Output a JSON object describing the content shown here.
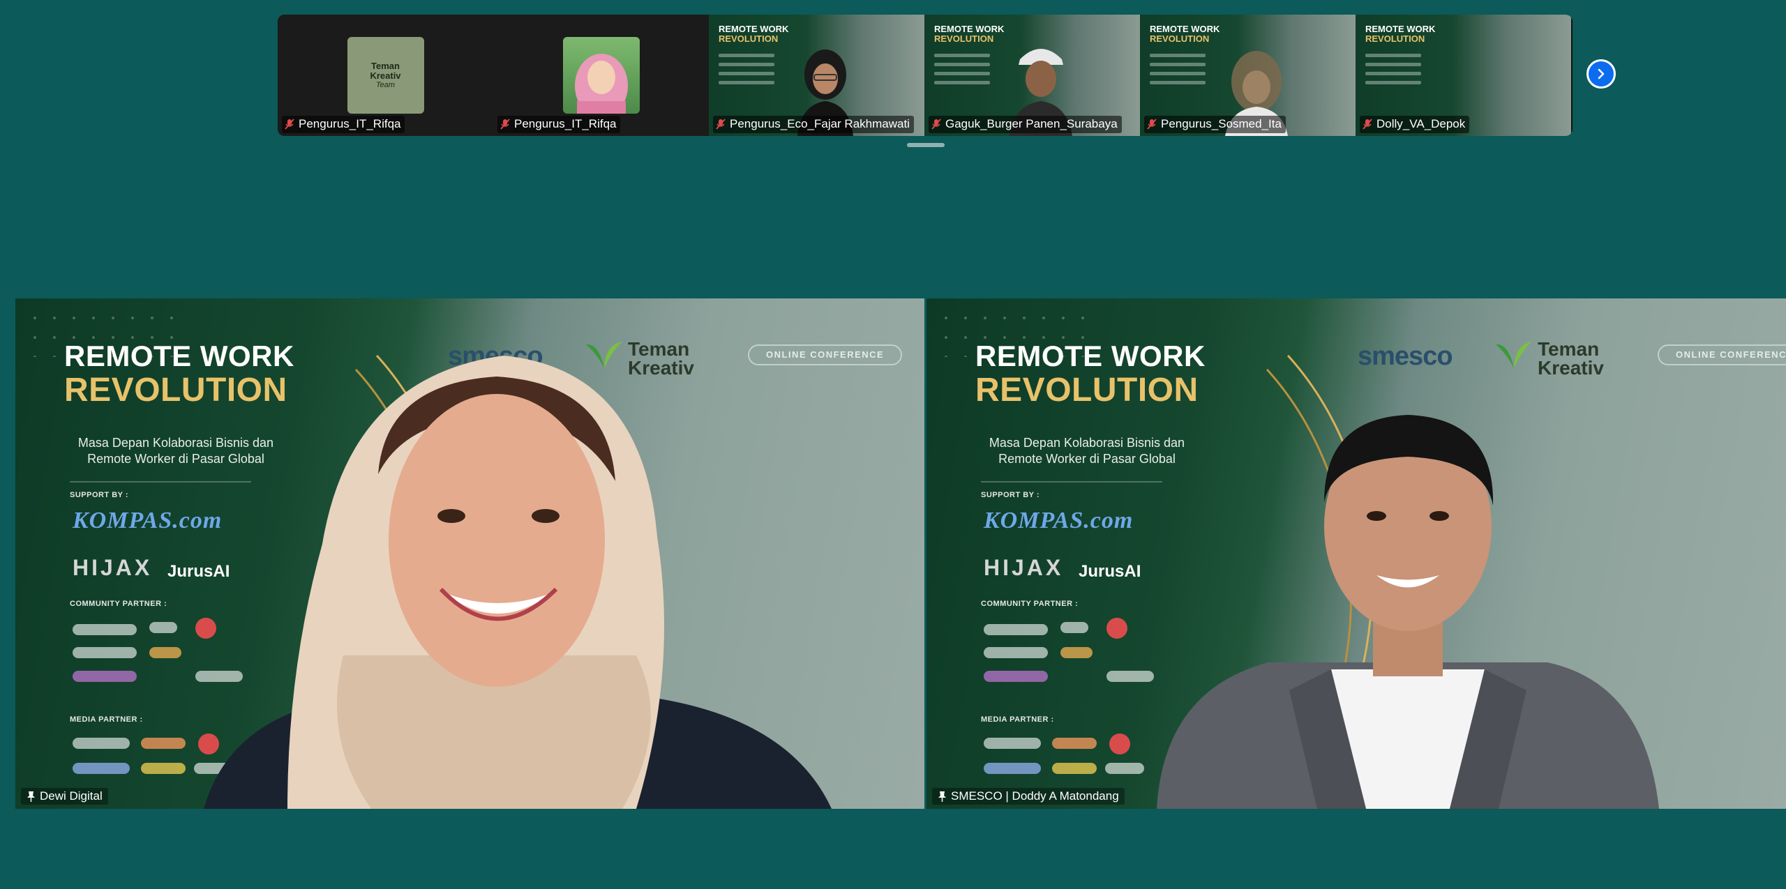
{
  "participants": [
    {
      "name": "Pengurus_IT_Rifqa",
      "tile": "avatar-teman",
      "avatar_text": [
        "Teman",
        "Kreativ",
        "Team"
      ],
      "muted": true
    },
    {
      "name": "Pengurus_IT_Rifqa",
      "tile": "avatar-hijab",
      "muted": true
    },
    {
      "name": "Pengurus_Eco_Fajar Rakhmawati",
      "tile": "video",
      "muted": true
    },
    {
      "name": "Gaguk_Burger Panen_Surabaya",
      "tile": "video",
      "muted": true
    },
    {
      "name": "Pengurus_Sosmed_Ita",
      "tile": "video",
      "muted": true
    },
    {
      "name": "Dolly_VA_Depok",
      "tile": "video",
      "muted": true
    }
  ],
  "poster": {
    "title_line1": "REMOTE WORK",
    "title_line2": "REVOLUTION",
    "subtitle_line1": "Masa Depan Kolaborasi Bisnis dan",
    "subtitle_line2": "Remote Worker di Pasar Global",
    "support_label": "SUPPORT BY :",
    "community_label": "COMMUNITY PARTNER :",
    "media_label": "MEDIA PARTNER :",
    "logo_kompas": "KOMPAS.com",
    "logo_hijax": "HIJAX",
    "logo_jurus": "JurusAI",
    "brand_smesco": "smesco",
    "brand_teman_1": "Teman",
    "brand_teman_2": "Kreativ",
    "online_conference": "ONLINE CONFERENCE",
    "mini_title_1": "REMOTE WORK",
    "mini_title_2": "REVOLUTION"
  },
  "speakers": [
    {
      "name": "Dewi Digital",
      "pinned": true
    },
    {
      "name": "SMESCO | Doddy A Matondang",
      "pinned": true
    }
  ],
  "colors": {
    "background": "#0c5a59",
    "accent_blue": "#0b6cf0",
    "gold": "#e8c26a",
    "muted_red": "#e14b4b"
  }
}
